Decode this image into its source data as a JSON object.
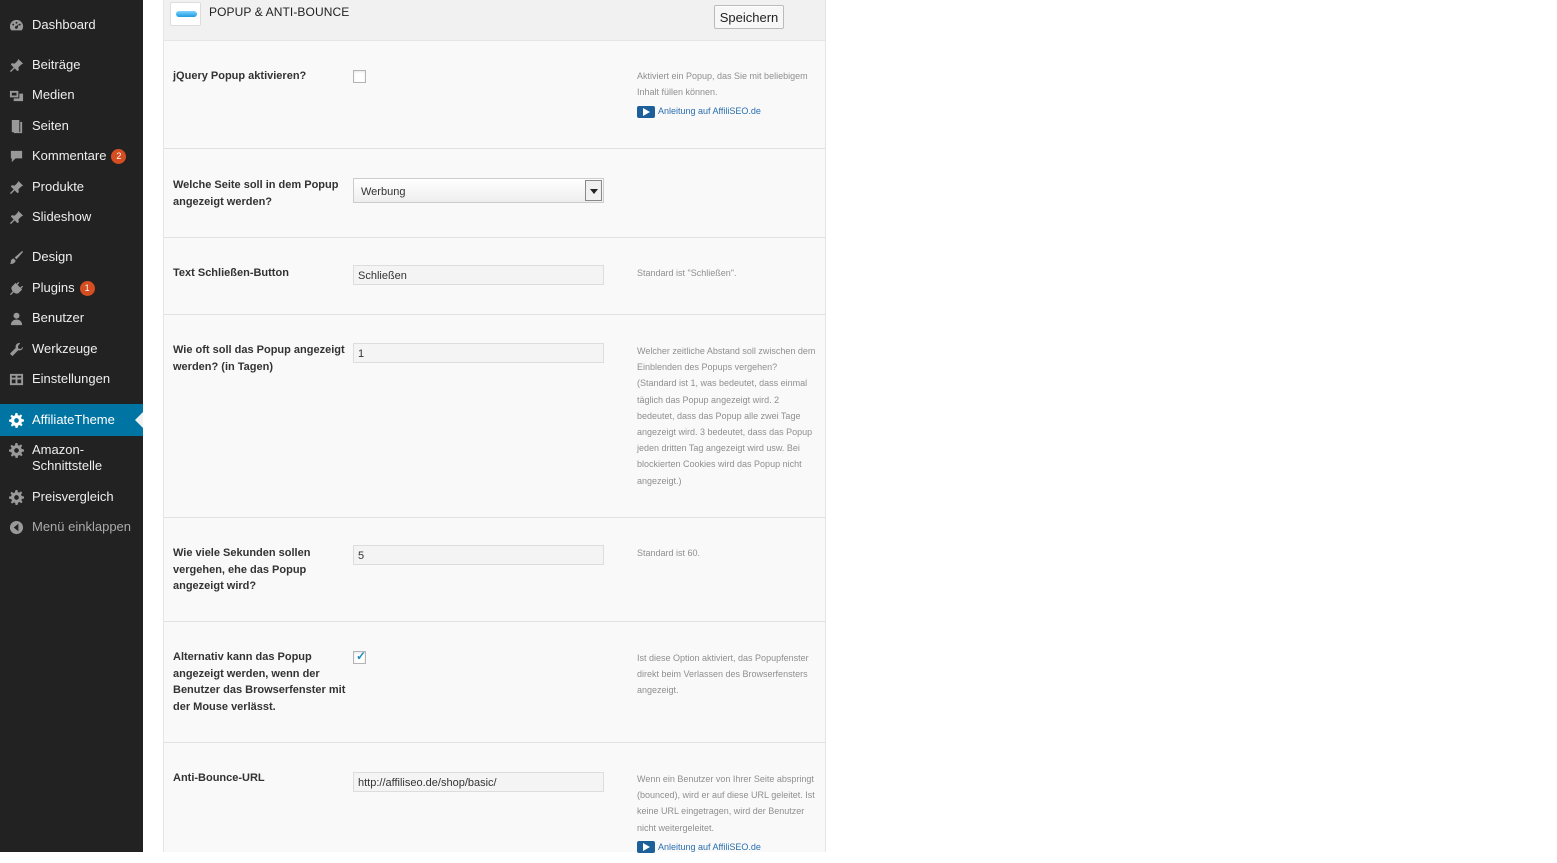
{
  "sidebar": {
    "items": [
      {
        "label": "Dashboard",
        "icon": "dashboard-icon"
      },
      {
        "label": "Beiträge",
        "icon": "pin-icon"
      },
      {
        "label": "Medien",
        "icon": "media-icon"
      },
      {
        "label": "Seiten",
        "icon": "pages-icon"
      },
      {
        "label": "Kommentare",
        "icon": "comments-icon",
        "badge": "2"
      },
      {
        "label": "Produkte",
        "icon": "pin-icon"
      },
      {
        "label": "Slideshow",
        "icon": "pin-icon"
      },
      {
        "label": "Design",
        "icon": "brush-icon"
      },
      {
        "label": "Plugins",
        "icon": "plugins-icon",
        "badge": "1"
      },
      {
        "label": "Benutzer",
        "icon": "user-icon"
      },
      {
        "label": "Werkzeuge",
        "icon": "wrench-icon"
      },
      {
        "label": "Einstellungen",
        "icon": "settings-icon"
      },
      {
        "label": "AffiliateTheme",
        "icon": "gear-icon",
        "active": true
      },
      {
        "label": "Amazon-Schnittstelle",
        "label_line1": "Amazon-",
        "label_line2": "Schnittstelle",
        "icon": "gear-icon"
      },
      {
        "label": "Preisvergleich",
        "icon": "gear-icon"
      },
      {
        "label": "Menü einklappen",
        "icon": "collapse-icon"
      }
    ],
    "colors": {
      "background": "#222222",
      "active": "#0074a2",
      "badge": "#d54e21"
    }
  },
  "panel": {
    "title": "POPUP & ANTI-BOUNCE",
    "save_label": "Speichern"
  },
  "settings": {
    "popup_enable": {
      "label": "jQuery Popup aktivieren?",
      "checked": false,
      "help": "Aktiviert ein Popup, das Sie mit beliebigem Inhalt füllen können.",
      "link": "Anleitung auf AffiliSEO.de"
    },
    "popup_page": {
      "label": "Welche Seite soll in dem Popup angezeigt werden?",
      "value": "Werbung"
    },
    "close_text": {
      "label": "Text Schließen-Button",
      "value": "Schließen",
      "help": "Standard ist \"Schließen\"."
    },
    "interval": {
      "label": "Wie oft soll das Popup angezeigt werden? (in Tagen)",
      "value": "1",
      "help": "Welcher zeitliche Abstand soll zwischen dem Einblenden des Popups vergehen? (Standard ist 1, was bedeutet, dass einmal täglich das Popup angezeigt wird. 2 bedeutet, dass das Popup alle zwei Tage angezeigt wird. 3 bedeutet, dass das Popup jeden dritten Tag angezeigt wird usw. Bei blockierten Cookies wird das Popup nicht angezeigt.)"
    },
    "delay": {
      "label": "Wie viele Sekunden sollen vergehen, ehe das Popup angezeigt wird?",
      "value": "5",
      "help": "Standard ist 60."
    },
    "exit_intent": {
      "label": "Alternativ kann das Popup angezeigt werden, wenn der Benutzer das Browserfenster mit der Mouse verlässt.",
      "checked": true,
      "help": "Ist diese Option aktiviert, das Popupfenster direkt beim Verlassen des Browserfensters angezeigt."
    },
    "anti_bounce_url": {
      "label": "Anti-Bounce-URL",
      "value": "http://affiliseo.de/shop/basic/",
      "help": "Wenn ein Benutzer von Ihrer Seite abspringt (bounced), wird er auf diese URL geleitet. Ist keine URL eingetragen, wird der Benutzer nicht weitergeleitet.",
      "link": "Anleitung auf AffiliSEO.de"
    }
  }
}
